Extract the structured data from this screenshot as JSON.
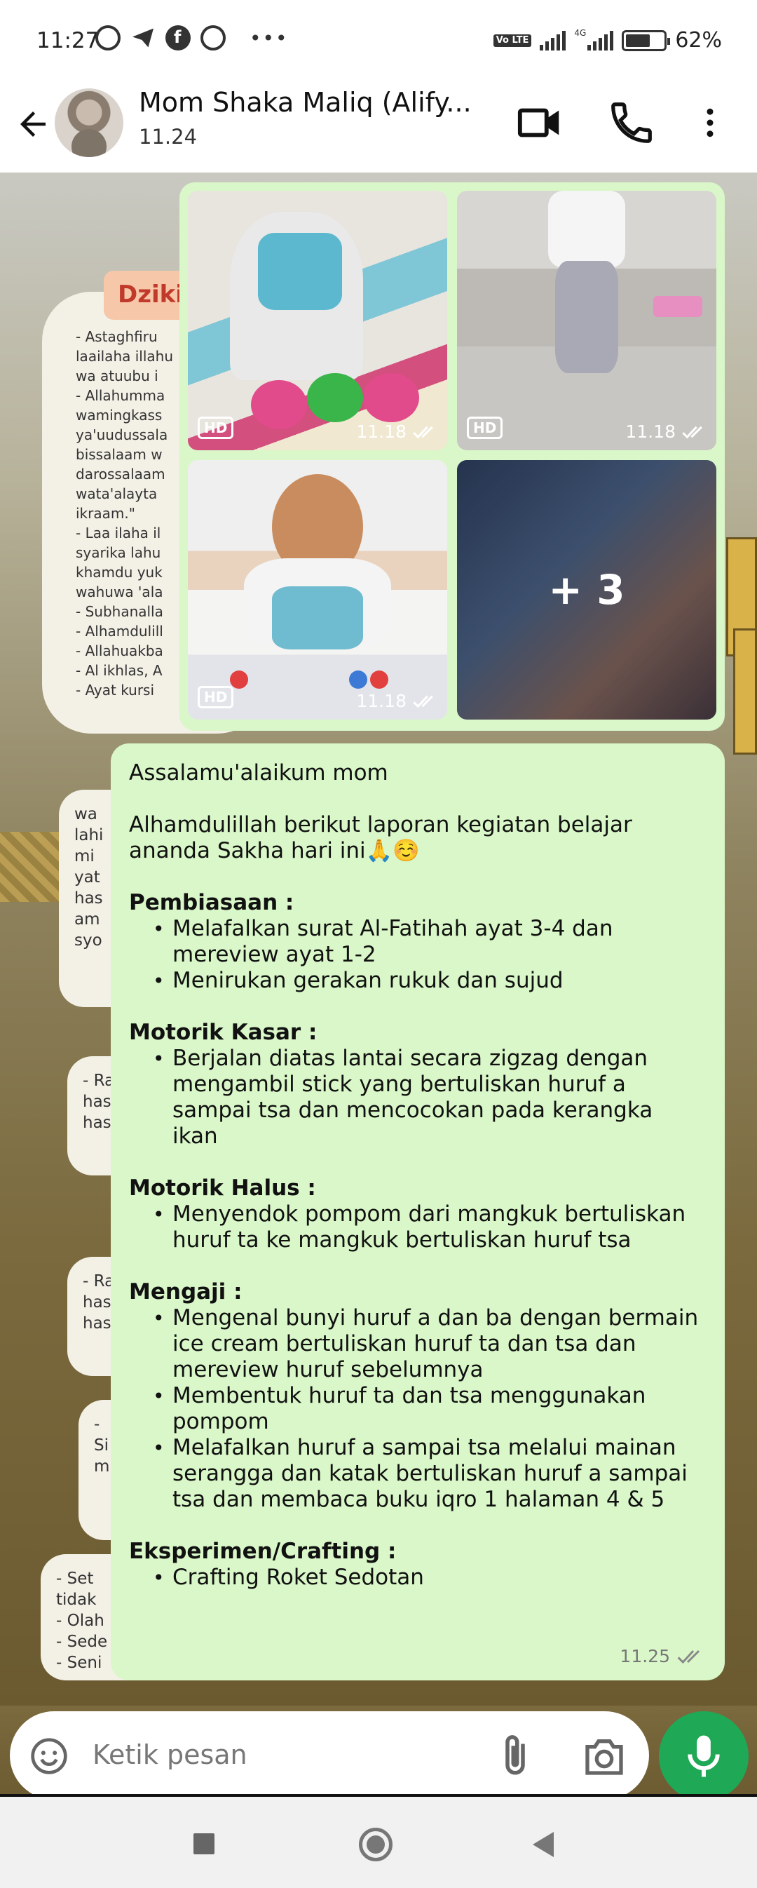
{
  "status_bar": {
    "time": "11:27",
    "volte": "Vo LTE",
    "network_label": "4G",
    "battery": "62%"
  },
  "header": {
    "contact_name": "Mom Shaka Maliq (Alify...",
    "last_seen": "11.24"
  },
  "background": {
    "title": "Dzikir",
    "doc_lines": "- Astaghfiru\nlaailaha illahu\nwa atuubu i\n- Allahumma\nwamingkass\nya'uudussala\nbissalaam w\ndarossalaam\nwata'alayta\nikraam.\"\n- Laa ilaha il\nsyarika lahu\nkhamdu yuk\nwahuwa 'ala\n- Subhanalla\n- Alhamdulill\n- Allahuakba\n- Al ikhlas, A\n- Ayat kursi",
    "card_1": "wa\nlahi\nmi\nyat\nhas\nam\nsyo",
    "card_2": "- Ra\nhas\nhas",
    "card_3": "- Ra\nhas\nhas",
    "card_4": "-\nSi\nm",
    "card_5": "- Set\ntidak\n- Olah\n- Sede\n- Seni"
  },
  "image_message": {
    "tiles": [
      {
        "hd": "HD",
        "time": "11.18"
      },
      {
        "hd": "HD",
        "time": "11.18"
      },
      {
        "hd": "HD",
        "time": "11.18"
      },
      {
        "overlay": "+ 3"
      }
    ]
  },
  "text_message": {
    "greeting": "Assalamu'alaikum mom",
    "intro": "Alhamdulillah berikut laporan kegiatan belajar ananda Sakha hari ini🙏☺️",
    "sections": [
      {
        "heading": "Pembiasaan :",
        "items": [
          "Melafalkan surat Al-Fatihah ayat 3-4 dan mereview ayat 1-2",
          "Menirukan gerakan rukuk dan sujud"
        ]
      },
      {
        "heading": "Motorik Kasar :",
        "items": [
          "Berjalan diatas lantai secara zigzag dengan mengambil stick yang bertuliskan huruf a sampai tsa dan mencocokan pada kerangka ikan"
        ]
      },
      {
        "heading": "Motorik Halus :",
        "items": [
          "Menyendok pompom dari mangkuk bertuliskan huruf ta ke mangkuk bertuliskan huruf tsa"
        ]
      },
      {
        "heading": "Mengaji :",
        "items": [
          "Mengenal bunyi huruf a dan ba dengan bermain ice cream bertuliskan huruf ta dan tsa dan mereview huruf sebelumnya",
          "Membentuk huruf ta dan tsa menggunakan pompom",
          "Melafalkan huruf a sampai tsa melalui mainan serangga dan katak bertuliskan huruf a sampai tsa dan membaca buku iqro 1 halaman 4 & 5"
        ]
      },
      {
        "heading": "Eksperimen/Crafting :",
        "items": [
          "Crafting Roket Sedotan"
        ]
      }
    ],
    "time": "11.25"
  },
  "composer": {
    "placeholder": "Ketik pesan"
  },
  "colors": {
    "bubble": "#d9f7c8",
    "accent_green": "#1fa855"
  },
  "icons": [
    "back-arrow-icon",
    "video-call-icon",
    "phone-icon",
    "more-vert-icon",
    "emoji-icon",
    "attach-icon",
    "camera-icon",
    "mic-icon",
    "double-check-icon",
    "alarm-icon",
    "telegram-icon",
    "facebook-icon",
    "messenger-icon"
  ]
}
